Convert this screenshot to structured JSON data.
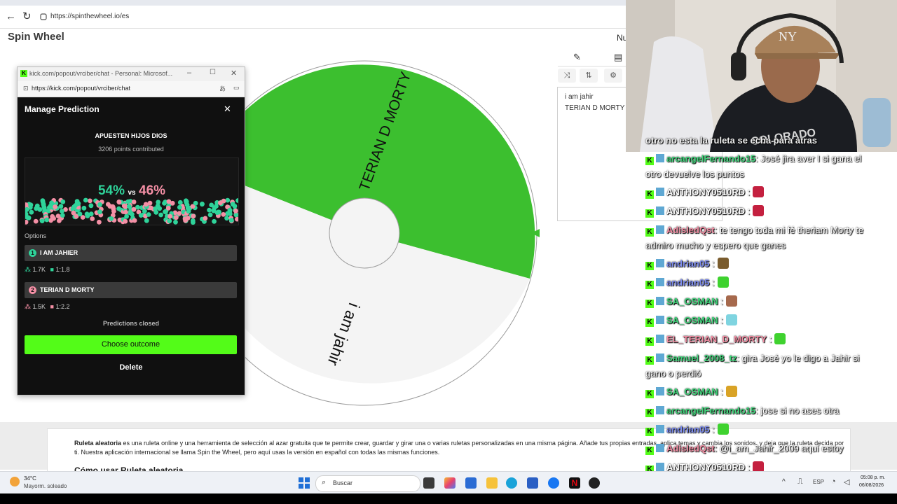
{
  "browser": {
    "url": "https://spinthewheel.io/es",
    "back_icon": "←",
    "reload_icon": "↻"
  },
  "site": {
    "brand": "Spin Wheel",
    "language_cut": "Nu"
  },
  "wheel": {
    "slices": [
      {
        "label": "TERIAN D MORTY",
        "color": "#3cbf2f"
      },
      {
        "label": "i am jahir",
        "color": "#f3f3f3"
      }
    ]
  },
  "editor": {
    "entries": [
      "i am jahir",
      "TERIAN D MORTY"
    ]
  },
  "popup": {
    "window_title": "kick.com/popout/vrciber/chat - Personal: Microsof...",
    "url": "https://kick.com/popout/vrciber/chat",
    "heading": "Manage Prediction",
    "question": "APUESTEN HIJOS DIOS",
    "points": "3206 points contributed",
    "pct_left": "54%",
    "pct_vs": "vs",
    "pct_right": "46%",
    "options_label": "Options",
    "options": [
      {
        "num": "1",
        "label": "I AM JAHIER",
        "people": "1.7K",
        "ratio": "1:1.8",
        "color": "#2fd39a"
      },
      {
        "num": "2",
        "label": "TERIAN D MORTY",
        "people": "1.5K",
        "ratio": "1:2.2",
        "color": "#f48fa5"
      }
    ],
    "status": "Predictions closed",
    "choose_label": "Choose outcome",
    "delete_label": "Delete",
    "colors": {
      "green": "#53fc18",
      "teal": "#2fd39a",
      "pink": "#f48fa5"
    }
  },
  "page_text": {
    "desc_bold": "Ruleta aleatoria",
    "desc": " es una ruleta online y una herramienta de selección al azar gratuita que te permite crear, guardar y girar una o varias ruletas personalizadas en una misma página. Añade tus propias entradas, aplica temas y cambia los sonidos, y deja que la ruleta decida por ti. Nuestra aplicación internacional se llama Spin the Wheel, pero aquí usas la versión en español con todas las mismas funciones.",
    "howto": "Cómo usar Ruleta aleatoria"
  },
  "stream_overlay": {
    "top_partial": "otro no esta la ruleta se echa para atras",
    "messages": [
      {
        "user": "arcangelFernando15",
        "color": "#3fd47a",
        "text": ": José jira aver I si gana el",
        "cont": "otro devuelve los puntos"
      },
      {
        "user": "ANTHONY0510RD",
        "color": "#ffffff",
        "text": " :"
      },
      {
        "user": "ANTHONY0510RD",
        "color": "#ffffff",
        "text": " :"
      },
      {
        "user": "AdisledQst",
        "color": "#f48fa5",
        "text": ": te tengo toda mi fé theriam Morty te",
        "cont": "admiro mucho y espero que ganes"
      },
      {
        "user": "andrian05",
        "color": "#7d8cf0",
        "text": " :"
      },
      {
        "user": "andrian05",
        "color": "#7d8cf0",
        "text": " :"
      },
      {
        "user": "SA_OSMAN",
        "color": "#3fd47a",
        "text": " :"
      },
      {
        "user": "SA_OSMAN",
        "color": "#3fd47a",
        "text": " :"
      },
      {
        "user": "EL_TERIAN_D_MORTY",
        "color": "#f48fa5",
        "text": " :"
      },
      {
        "user": "Samuel_2008_tz",
        "color": "#3fd47a",
        "text": ": gira José yo le digo a Jahir si",
        "cont": "gano o perdió"
      },
      {
        "user": "SA_OSMAN",
        "color": "#3fd47a",
        "text": " :"
      },
      {
        "user": "arcangelFernando15",
        "color": "#3fd47a",
        "text": ": jose si no ases otra"
      },
      {
        "user": "andrian05",
        "color": "#7d8cf0",
        "text": " :"
      },
      {
        "user": "AdisledQst",
        "color": "#f48fa5",
        "text": ": @i_am_Jahir_2009 aquí estoy"
      },
      {
        "user": "ANTHONY0510RD",
        "color": "#ffffff",
        "text": " :"
      }
    ]
  },
  "taskbar": {
    "weather_temp": "34°C",
    "weather_desc": "Mayorm. soleado",
    "search_placeholder": "Buscar",
    "lang": "ESP",
    "time": "05:08 p. m.",
    "date": "06/08/2026"
  }
}
